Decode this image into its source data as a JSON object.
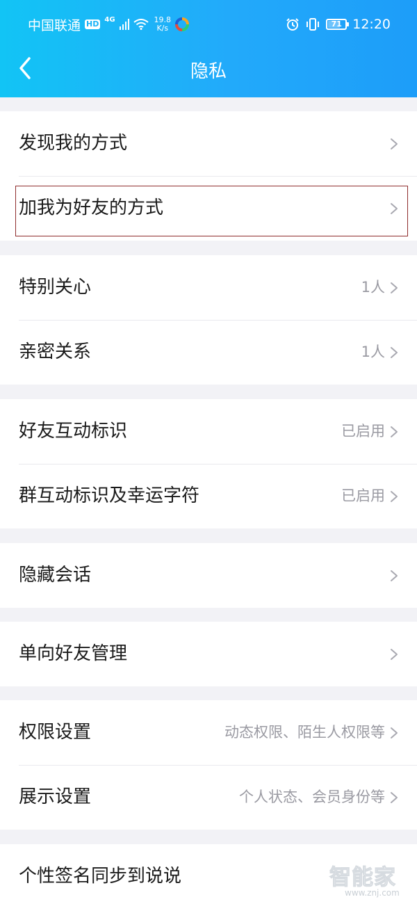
{
  "status_bar": {
    "carrier": "中国联通",
    "hd": "HD",
    "network": "4G",
    "speed_value": "19.8",
    "speed_unit": "K/s",
    "battery": "71",
    "battery_level": 0.71,
    "time": "12:20"
  },
  "header": {
    "title": "隐私",
    "back_icon": "chevron-left-icon"
  },
  "groups": [
    {
      "items": [
        {
          "label": "发现我的方式",
          "value": ""
        },
        {
          "label": "加我为好友的方式",
          "value": ""
        }
      ]
    },
    {
      "items": [
        {
          "label": "特别关心",
          "value": "1人"
        },
        {
          "label": "亲密关系",
          "value": "1人"
        }
      ]
    },
    {
      "items": [
        {
          "label": "好友互动标识",
          "value": "已启用"
        },
        {
          "label": "群互动标识及幸运字符",
          "value": "已启用"
        }
      ]
    },
    {
      "items": [
        {
          "label": "隐藏会话",
          "value": ""
        }
      ]
    },
    {
      "items": [
        {
          "label": "单向好友管理",
          "value": ""
        }
      ]
    },
    {
      "items": [
        {
          "label": "权限设置",
          "value": "动态权限、陌生人权限等"
        },
        {
          "label": "展示设置",
          "value": "个人状态、会员身份等"
        }
      ]
    },
    {
      "items": [
        {
          "label": "个性签名同步到说说",
          "value": ""
        }
      ]
    }
  ],
  "watermark": {
    "text": "智能家",
    "url": "www.znj.com"
  },
  "colors": {
    "header_gradient_start": "#12c4f5",
    "header_gradient_end": "#1d9df9",
    "background": "#f2f2f6",
    "highlight_border": "#8e2b2b"
  }
}
